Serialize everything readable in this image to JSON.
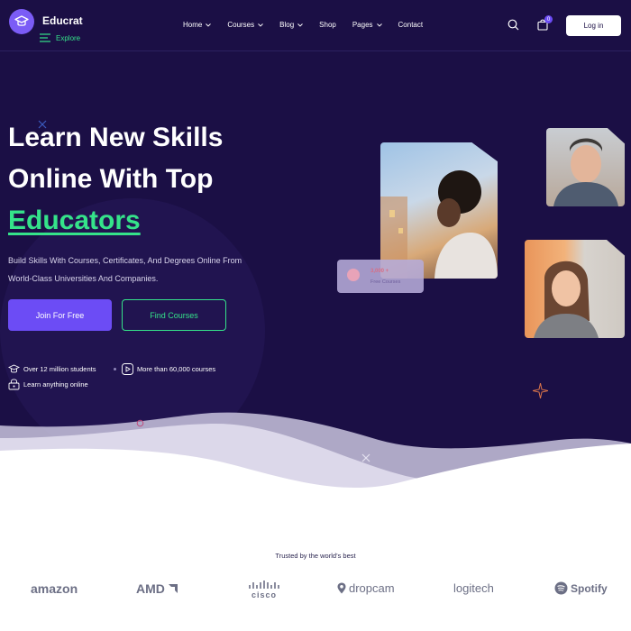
{
  "brand": {
    "name": "Educrat",
    "explore_label": "Explore",
    "accent": "#35e38a",
    "primary": "#6c4cf5",
    "background": "#1b0f45"
  },
  "nav": {
    "items": [
      {
        "label": "Home",
        "has_dropdown": true
      },
      {
        "label": "Courses",
        "has_dropdown": true
      },
      {
        "label": "Blog",
        "has_dropdown": true
      },
      {
        "label": "Shop",
        "has_dropdown": false
      },
      {
        "label": "Pages",
        "has_dropdown": true
      },
      {
        "label": "Contact",
        "has_dropdown": false
      }
    ],
    "cart_count": "0",
    "login_label": "Log in"
  },
  "hero": {
    "line1": "Learn New Skills",
    "line2": "Online With Top",
    "line3": "Educators",
    "subtext_line1": "Build Skills With Courses, Certificates, And Degrees Online From",
    "subtext_line2": "World-Class Universities And Companies.",
    "join_label": "Join For Free",
    "find_label": "Find Courses",
    "features": [
      {
        "icon": "graduation-cap-icon",
        "text": "Over 12 million students"
      },
      {
        "icon": "play-icon",
        "text": "More than 60,000 courses"
      },
      {
        "icon": "lock-icon",
        "text": "Learn anything online"
      }
    ],
    "course_badge": {
      "count": "3,000 +",
      "label": "Free Courses"
    }
  },
  "trusted": {
    "heading": "Trusted by the world’s best",
    "brands": [
      "amazon",
      "AMD",
      "cisco",
      "dropcam",
      "logitech",
      "Spotify"
    ]
  }
}
